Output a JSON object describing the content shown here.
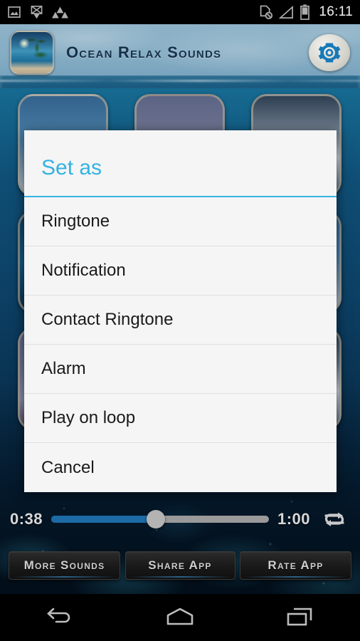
{
  "statusbar": {
    "time": "16:11",
    "left_icons": [
      {
        "name": "gallery-image-icon"
      },
      {
        "name": "download-complete-icon"
      },
      {
        "name": "triangles-app-icon"
      }
    ],
    "right_icons": [
      {
        "name": "no-sim-card-icon"
      },
      {
        "name": "signal-strength-icon"
      },
      {
        "name": "battery-icon"
      }
    ]
  },
  "header": {
    "title": "Ocean Relax Sounds",
    "app_icon_name": "beach-thumbnail-icon",
    "settings_icon_name": "gear-icon"
  },
  "dialog": {
    "title": "Set as",
    "accent_color": "#34b3e0",
    "background_color": "#f5f5f5",
    "items": [
      {
        "label": "Ringtone"
      },
      {
        "label": "Notification"
      },
      {
        "label": "Contact Ringtone"
      },
      {
        "label": "Alarm"
      },
      {
        "label": "Play on loop"
      },
      {
        "label": "Cancel"
      }
    ]
  },
  "player": {
    "current_time": "0:38",
    "total_time": "1:00",
    "progress_percent": 48,
    "fill_color": "#1c6aa6",
    "track_color": "#9a9a9a",
    "loop_icon_name": "repeat-loop-icon"
  },
  "bottom_buttons": [
    {
      "label": "More Sounds"
    },
    {
      "label": "Share App"
    },
    {
      "label": "Rate App"
    }
  ],
  "navbar": {
    "back_label": "back-icon",
    "home_label": "home-icon",
    "recents_label": "recents-icon"
  }
}
